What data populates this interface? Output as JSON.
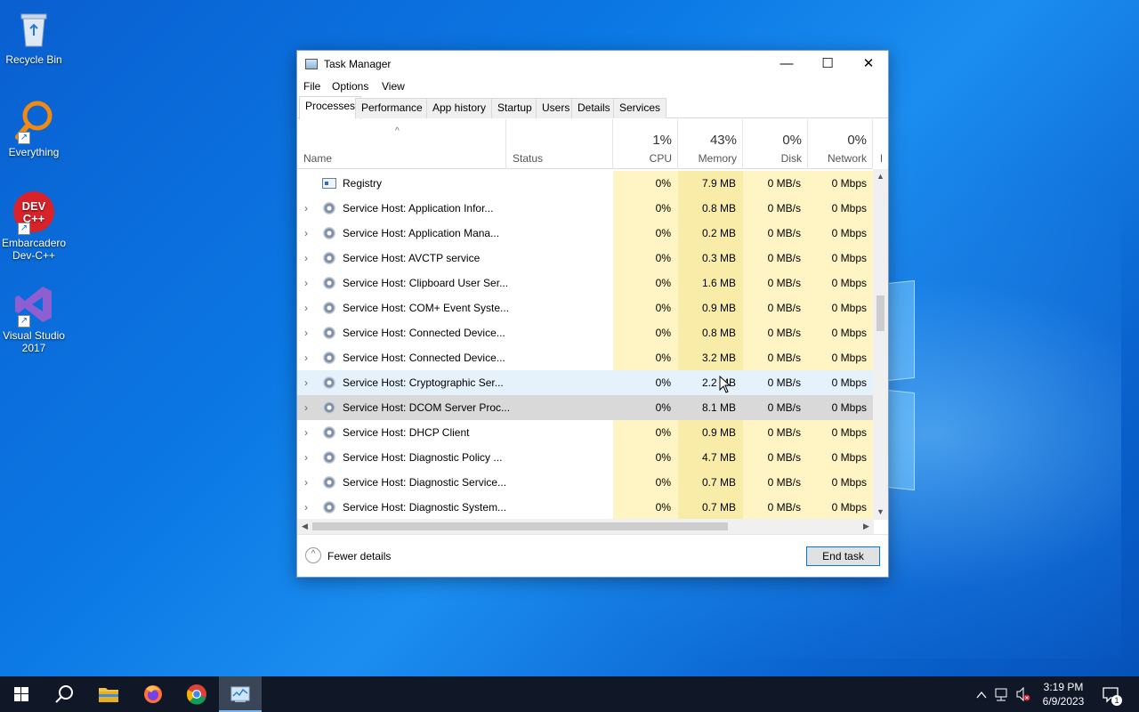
{
  "desktop": {
    "icons": [
      {
        "label": "Recycle Bin"
      },
      {
        "label": "Everything"
      },
      {
        "label": "Embarcadero Dev-C++"
      },
      {
        "label": "Visual Studio 2017"
      }
    ]
  },
  "window": {
    "title": "Task Manager",
    "minimize": "—",
    "maximize": "☐",
    "close": "✕"
  },
  "menu": [
    "File",
    "Options",
    "View"
  ],
  "tabs": [
    "Processes",
    "Performance",
    "App history",
    "Startup",
    "Users",
    "Details",
    "Services"
  ],
  "active_tab": "Processes",
  "columns": {
    "name": "Name",
    "status": "Status",
    "cpu": {
      "pct": "1%",
      "label": "CPU"
    },
    "memory": {
      "pct": "43%",
      "label": "Memory"
    },
    "disk": {
      "pct": "0%",
      "label": "Disk"
    },
    "network": {
      "pct": "0%",
      "label": "Network"
    },
    "power": "P"
  },
  "processes": [
    {
      "name": "Registry",
      "cpu": "0%",
      "memory": "7.9 MB",
      "disk": "0 MB/s",
      "network": "0 Mbps",
      "expandable": false,
      "icon": "registry-icon"
    },
    {
      "name": "Service Host: Application Infor...",
      "cpu": "0%",
      "memory": "0.8 MB",
      "disk": "0 MB/s",
      "network": "0 Mbps",
      "expandable": true,
      "icon": "gear-icon"
    },
    {
      "name": "Service Host: Application Mana...",
      "cpu": "0%",
      "memory": "0.2 MB",
      "disk": "0 MB/s",
      "network": "0 Mbps",
      "expandable": true,
      "icon": "gear-icon"
    },
    {
      "name": "Service Host: AVCTP service",
      "cpu": "0%",
      "memory": "0.3 MB",
      "disk": "0 MB/s",
      "network": "0 Mbps",
      "expandable": true,
      "icon": "gear-icon"
    },
    {
      "name": "Service Host: Clipboard User Ser...",
      "cpu": "0%",
      "memory": "1.6 MB",
      "disk": "0 MB/s",
      "network": "0 Mbps",
      "expandable": true,
      "icon": "gear-icon"
    },
    {
      "name": "Service Host: COM+ Event Syste...",
      "cpu": "0%",
      "memory": "0.9 MB",
      "disk": "0 MB/s",
      "network": "0 Mbps",
      "expandable": true,
      "icon": "gear-icon"
    },
    {
      "name": "Service Host: Connected Device...",
      "cpu": "0%",
      "memory": "0.8 MB",
      "disk": "0 MB/s",
      "network": "0 Mbps",
      "expandable": true,
      "icon": "gear-icon"
    },
    {
      "name": "Service Host: Connected Device...",
      "cpu": "0%",
      "memory": "3.2 MB",
      "disk": "0 MB/s",
      "network": "0 Mbps",
      "expandable": true,
      "icon": "gear-icon"
    },
    {
      "name": "Service Host: Cryptographic Ser...",
      "cpu": "0%",
      "memory": "2.2 MB",
      "disk": "0 MB/s",
      "network": "0 Mbps",
      "expandable": true,
      "icon": "gear-icon",
      "state": "hover"
    },
    {
      "name": "Service Host: DCOM Server Proc...",
      "cpu": "0%",
      "memory": "8.1 MB",
      "disk": "0 MB/s",
      "network": "0 Mbps",
      "expandable": true,
      "icon": "gear-icon",
      "state": "selected"
    },
    {
      "name": "Service Host: DHCP Client",
      "cpu": "0%",
      "memory": "0.9 MB",
      "disk": "0 MB/s",
      "network": "0 Mbps",
      "expandable": true,
      "icon": "gear-icon"
    },
    {
      "name": "Service Host: Diagnostic Policy ...",
      "cpu": "0%",
      "memory": "4.7 MB",
      "disk": "0 MB/s",
      "network": "0 Mbps",
      "expandable": true,
      "icon": "gear-icon"
    },
    {
      "name": "Service Host: Diagnostic Service...",
      "cpu": "0%",
      "memory": "0.7 MB",
      "disk": "0 MB/s",
      "network": "0 Mbps",
      "expandable": true,
      "icon": "gear-icon"
    },
    {
      "name": "Service Host: Diagnostic System...",
      "cpu": "0%",
      "memory": "0.7 MB",
      "disk": "0 MB/s",
      "network": "0 Mbps",
      "expandable": true,
      "icon": "gear-icon"
    }
  ],
  "footer": {
    "fewer_details": "Fewer details",
    "end_task": "End task"
  },
  "taskbar": {
    "clock_time": "3:19 PM",
    "clock_date": "6/9/2023",
    "notification_count": "1"
  },
  "colors": {
    "accent": "#0078d7",
    "cpu_tint": "#fff4c4",
    "memory_tint": "#f9eca8",
    "taskbar": "#101828"
  }
}
